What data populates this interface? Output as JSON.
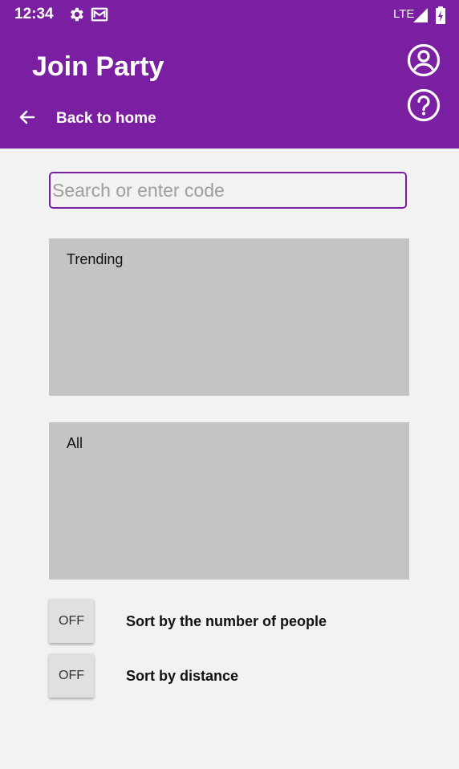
{
  "status_bar": {
    "time": "12:34",
    "icons": [
      "gear-icon",
      "mail-icon"
    ],
    "network": "LTE",
    "right_icons": [
      "signal-icon",
      "battery-icon"
    ]
  },
  "header": {
    "title": "Join Party",
    "back_label": "Back to home",
    "icons": [
      "back-arrow-icon",
      "account-icon",
      "help-icon"
    ],
    "color": "#7b1fa2"
  },
  "search": {
    "placeholder": "Search or enter code",
    "value": ""
  },
  "sections": {
    "trending_label": "Trending",
    "all_label": "All"
  },
  "sort_options": [
    {
      "state": "OFF",
      "label": "Sort by the number of people"
    },
    {
      "state": "OFF",
      "label": "Sort by distance"
    }
  ]
}
